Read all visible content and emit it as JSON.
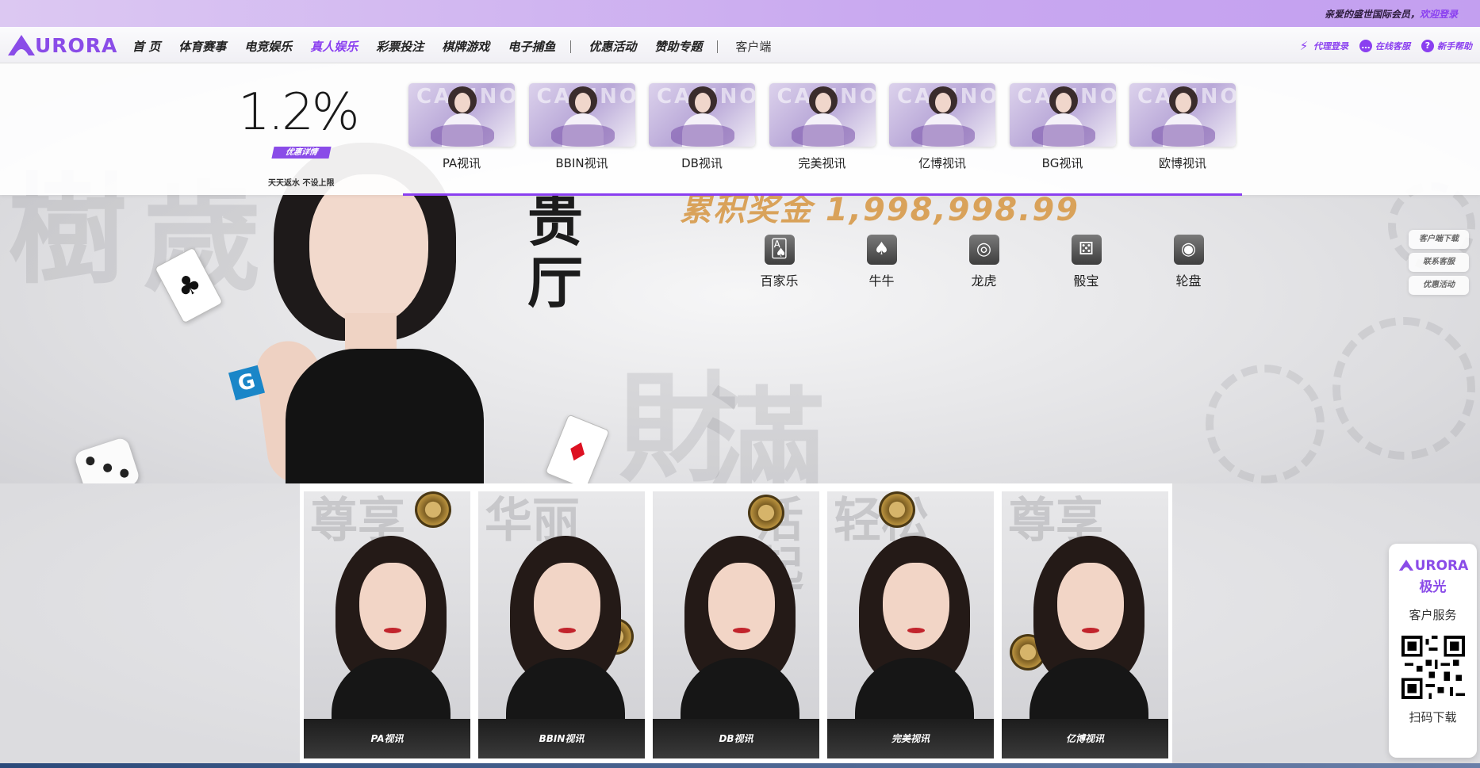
{
  "topbar": {
    "welcome_prefix": "亲爱的盛世国际会员，",
    "welcome_link": "欢迎登录"
  },
  "logo": {
    "text": "URORA"
  },
  "nav": {
    "items": [
      "首 页",
      "体育赛事",
      "电竞娱乐",
      "真人娱乐",
      "彩票投注",
      "棋牌游戏",
      "电子捕鱼",
      "优惠活动",
      "赞助专题"
    ],
    "active": "真人娱乐",
    "client": "客户端",
    "right": [
      {
        "label": "代理登录",
        "icon": "bolt-icon"
      },
      {
        "label": "在线客服",
        "icon": "chat-icon"
      },
      {
        "label": "新手帮助",
        "icon": "help-icon"
      }
    ]
  },
  "dropdown": {
    "promo": {
      "percent": "1.2%",
      "button": "优惠详情",
      "desc": "天天返水  不设上限"
    },
    "providers": [
      "PA视讯",
      "BBIN视讯",
      "DB视讯",
      "完美视讯",
      "亿博视讯",
      "BG视讯",
      "欧博视讯"
    ]
  },
  "hero": {
    "tagline_col1": "贵",
    "tagline_col2": "厅",
    "jackpot": "累积奖金  1,998,998.99",
    "games": [
      {
        "label": "百家乐",
        "icon": "cards-icon"
      },
      {
        "label": "牛牛",
        "icon": "spade-icon"
      },
      {
        "label": "龙虎",
        "icon": "dragon-icon"
      },
      {
        "label": "骰宝",
        "icon": "dice-icon"
      },
      {
        "label": "轮盘",
        "icon": "roulette-icon"
      }
    ],
    "side_buttons": [
      "客户端下载",
      "联系客服",
      "优惠活动"
    ]
  },
  "tiles": [
    {
      "label": "PA视讯",
      "calli": "尊享"
    },
    {
      "label": "BBIN视讯",
      "calli": "华丽"
    },
    {
      "label": "DB视讯",
      "calli": "活起"
    },
    {
      "label": "完美视讯",
      "calli": "轻松"
    },
    {
      "label": "亿博视讯",
      "calli": "尊享"
    }
  ],
  "service": {
    "brand": "URORA",
    "brand_cn": "极光",
    "title": "客户服务",
    "scan": "扫码下载"
  },
  "colors": {
    "accent": "#8a3ff0",
    "topstrip": "#c9a9f0"
  }
}
